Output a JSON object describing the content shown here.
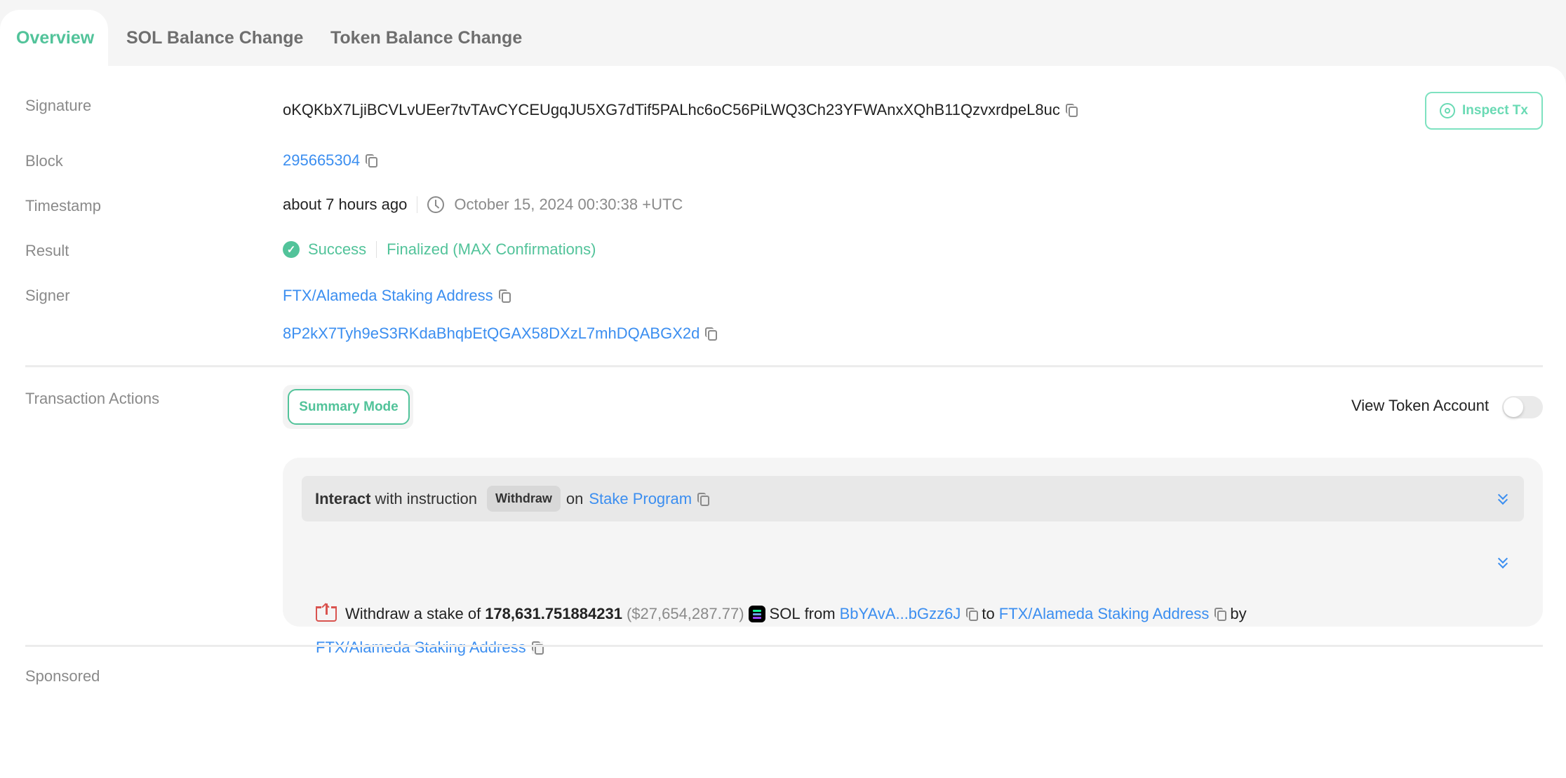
{
  "tabs": [
    {
      "label": "Overview",
      "active": true
    },
    {
      "label": "SOL Balance Change",
      "active": false
    },
    {
      "label": "Token Balance Change",
      "active": false
    }
  ],
  "overview": {
    "signature": {
      "label": "Signature",
      "value": "oKQKbX7LjiBCVLvUEer7tvTAvCYCEUgqJU5XG7dTif5PALhc6oC56PiLWQ3Ch23YFWAnxXQhB11QzvxrdpeL8uc"
    },
    "inspect_button": {
      "label": "Inspect Tx",
      "icon": "eye-icon"
    },
    "block": {
      "label": "Block",
      "value": "295665304"
    },
    "timestamp": {
      "label": "Timestamp",
      "relative": "about 7 hours ago",
      "absolute": "October 15, 2024 00:30:38 +UTC"
    },
    "result": {
      "label": "Result",
      "status": "Success",
      "confirmation": "Finalized (MAX Confirmations)"
    },
    "signer": {
      "label": "Signer",
      "name": "FTX/Alameda Staking Address",
      "address": "8P2kX7Tyh9eS3RKdaBhqbEtQGAX58DXzL7mhDQABGX2d"
    }
  },
  "actions": {
    "label": "Transaction Actions",
    "summary_mode": "Summary Mode",
    "view_token_account": {
      "label": "View Token Account",
      "enabled": false
    },
    "instruction": {
      "verb": "Interact",
      "with_text": "with instruction",
      "instruction_name": "Withdraw",
      "on_text": "on",
      "program": "Stake Program"
    },
    "detail": {
      "text_prefix": "Withdraw a stake of",
      "amount": "178,631.751884231",
      "usd_value": "($27,654,287.77)",
      "token": "SOL",
      "from_text": "from",
      "from_address": "BbYAvA...bGzz6J",
      "to_text": "to",
      "to_address": "FTX/Alameda Staking Address",
      "by_text": "by",
      "by_address": "FTX/Alameda Staking Address"
    }
  },
  "sponsored": {
    "label": "Sponsored"
  },
  "colors": {
    "accent_green": "#52c39a",
    "link_blue": "#3b8ef0",
    "withdraw_red": "#d9534f"
  }
}
